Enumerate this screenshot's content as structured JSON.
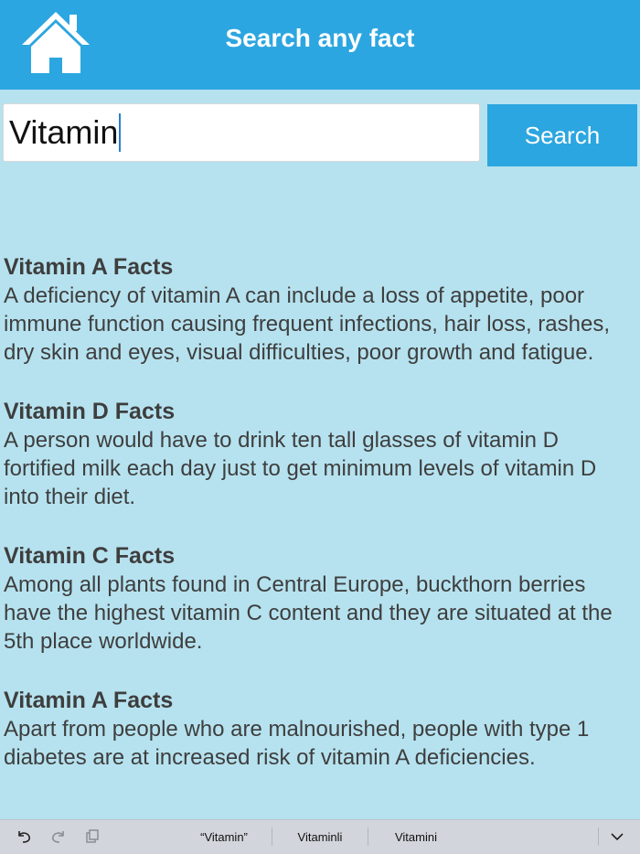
{
  "header": {
    "title": "Search any fact",
    "home_icon": "home-icon"
  },
  "search": {
    "value": "Vitamin",
    "button_label": "Search"
  },
  "results": [
    {
      "title": "Vitamin A Facts",
      "body": "A deficiency of vitamin A can include a loss of appetite, poor immune function causing frequent infections, hair loss, rashes, dry skin and eyes, visual difficulties, poor growth and fatigue."
    },
    {
      "title": "Vitamin D Facts",
      "body": "A person would have to drink ten tall glasses of vitamin D fortified milk each day just to get minimum levels of vitamin D into their diet."
    },
    {
      "title": "Vitamin C Facts",
      "body": "Among all plants found in Central Europe, buckthorn berries have the highest vitamin C content and they are situated at the 5th place worldwide."
    },
    {
      "title": "Vitamin A Facts",
      "body": "Apart from people who are malnourished, people with type 1 diabetes are at increased risk of vitamin A deficiencies."
    }
  ],
  "keyboard_bar": {
    "icons": [
      "undo-icon",
      "redo-icon",
      "paste-icon",
      "chevron-down-icon"
    ],
    "suggestions": [
      "“Vitamin”",
      "Vitaminli",
      "Vitamini"
    ]
  },
  "colors": {
    "header": "#2ca6e0",
    "background": "#b6e2ef",
    "button": "#2ca6e0",
    "text": "#3e3e3e"
  }
}
